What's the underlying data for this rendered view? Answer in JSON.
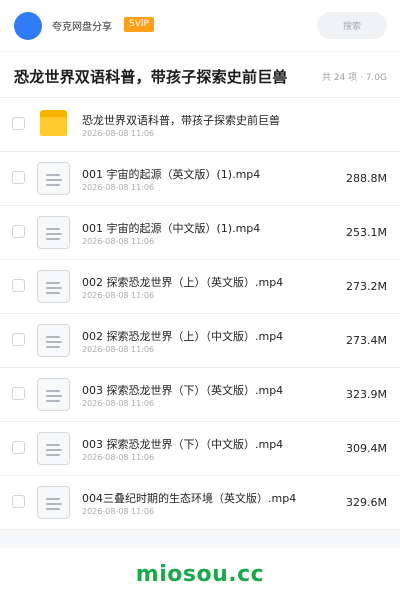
{
  "header": {
    "brand": "夸克网盘分享",
    "badge": "SVIP",
    "search_label": "搜索"
  },
  "title_bar": {
    "title": "恐龙世界双语科普，带孩子探索史前巨兽",
    "meta": "共 24 项 · 7.0G"
  },
  "items": [
    {
      "type": "folder",
      "name": "恐龙世界双语科普，带孩子探索史前巨兽",
      "date": "2026-08-08 11:06",
      "size": ""
    },
    {
      "type": "file",
      "name": "001 宇宙的起源（英文版）(1).mp4",
      "date": "2026-08-08 11:06",
      "size": "288.8M"
    },
    {
      "type": "file",
      "name": "001 宇宙的起源（中文版）(1).mp4",
      "date": "2026-08-08 11:06",
      "size": "253.1M"
    },
    {
      "type": "file",
      "name": "002 探索恐龙世界（上）（英文版）.mp4",
      "date": "2026-08-08 11:06",
      "size": "273.2M"
    },
    {
      "type": "file",
      "name": "002 探索恐龙世界（上）（中文版）.mp4",
      "date": "2026-08-08 11:06",
      "size": "273.4M"
    },
    {
      "type": "file",
      "name": "003 探索恐龙世界（下）（英文版）.mp4",
      "date": "2026-08-08 11:06",
      "size": "323.9M"
    },
    {
      "type": "file",
      "name": "003 探索恐龙世界（下）（中文版）.mp4",
      "date": "2026-08-08 11:06",
      "size": "309.4M"
    },
    {
      "type": "file",
      "name": "004三叠纪时期的生态环境（英文版）.mp4",
      "date": "2026-08-08 11:06",
      "size": "329.6M"
    }
  ],
  "footer": {
    "watermark": "miosou.cc"
  },
  "colors": {
    "avatar": "#2f7cf6",
    "badge": "#ff9f1a",
    "folder": "#ffcb2e",
    "watermark": "#1ba84a"
  }
}
